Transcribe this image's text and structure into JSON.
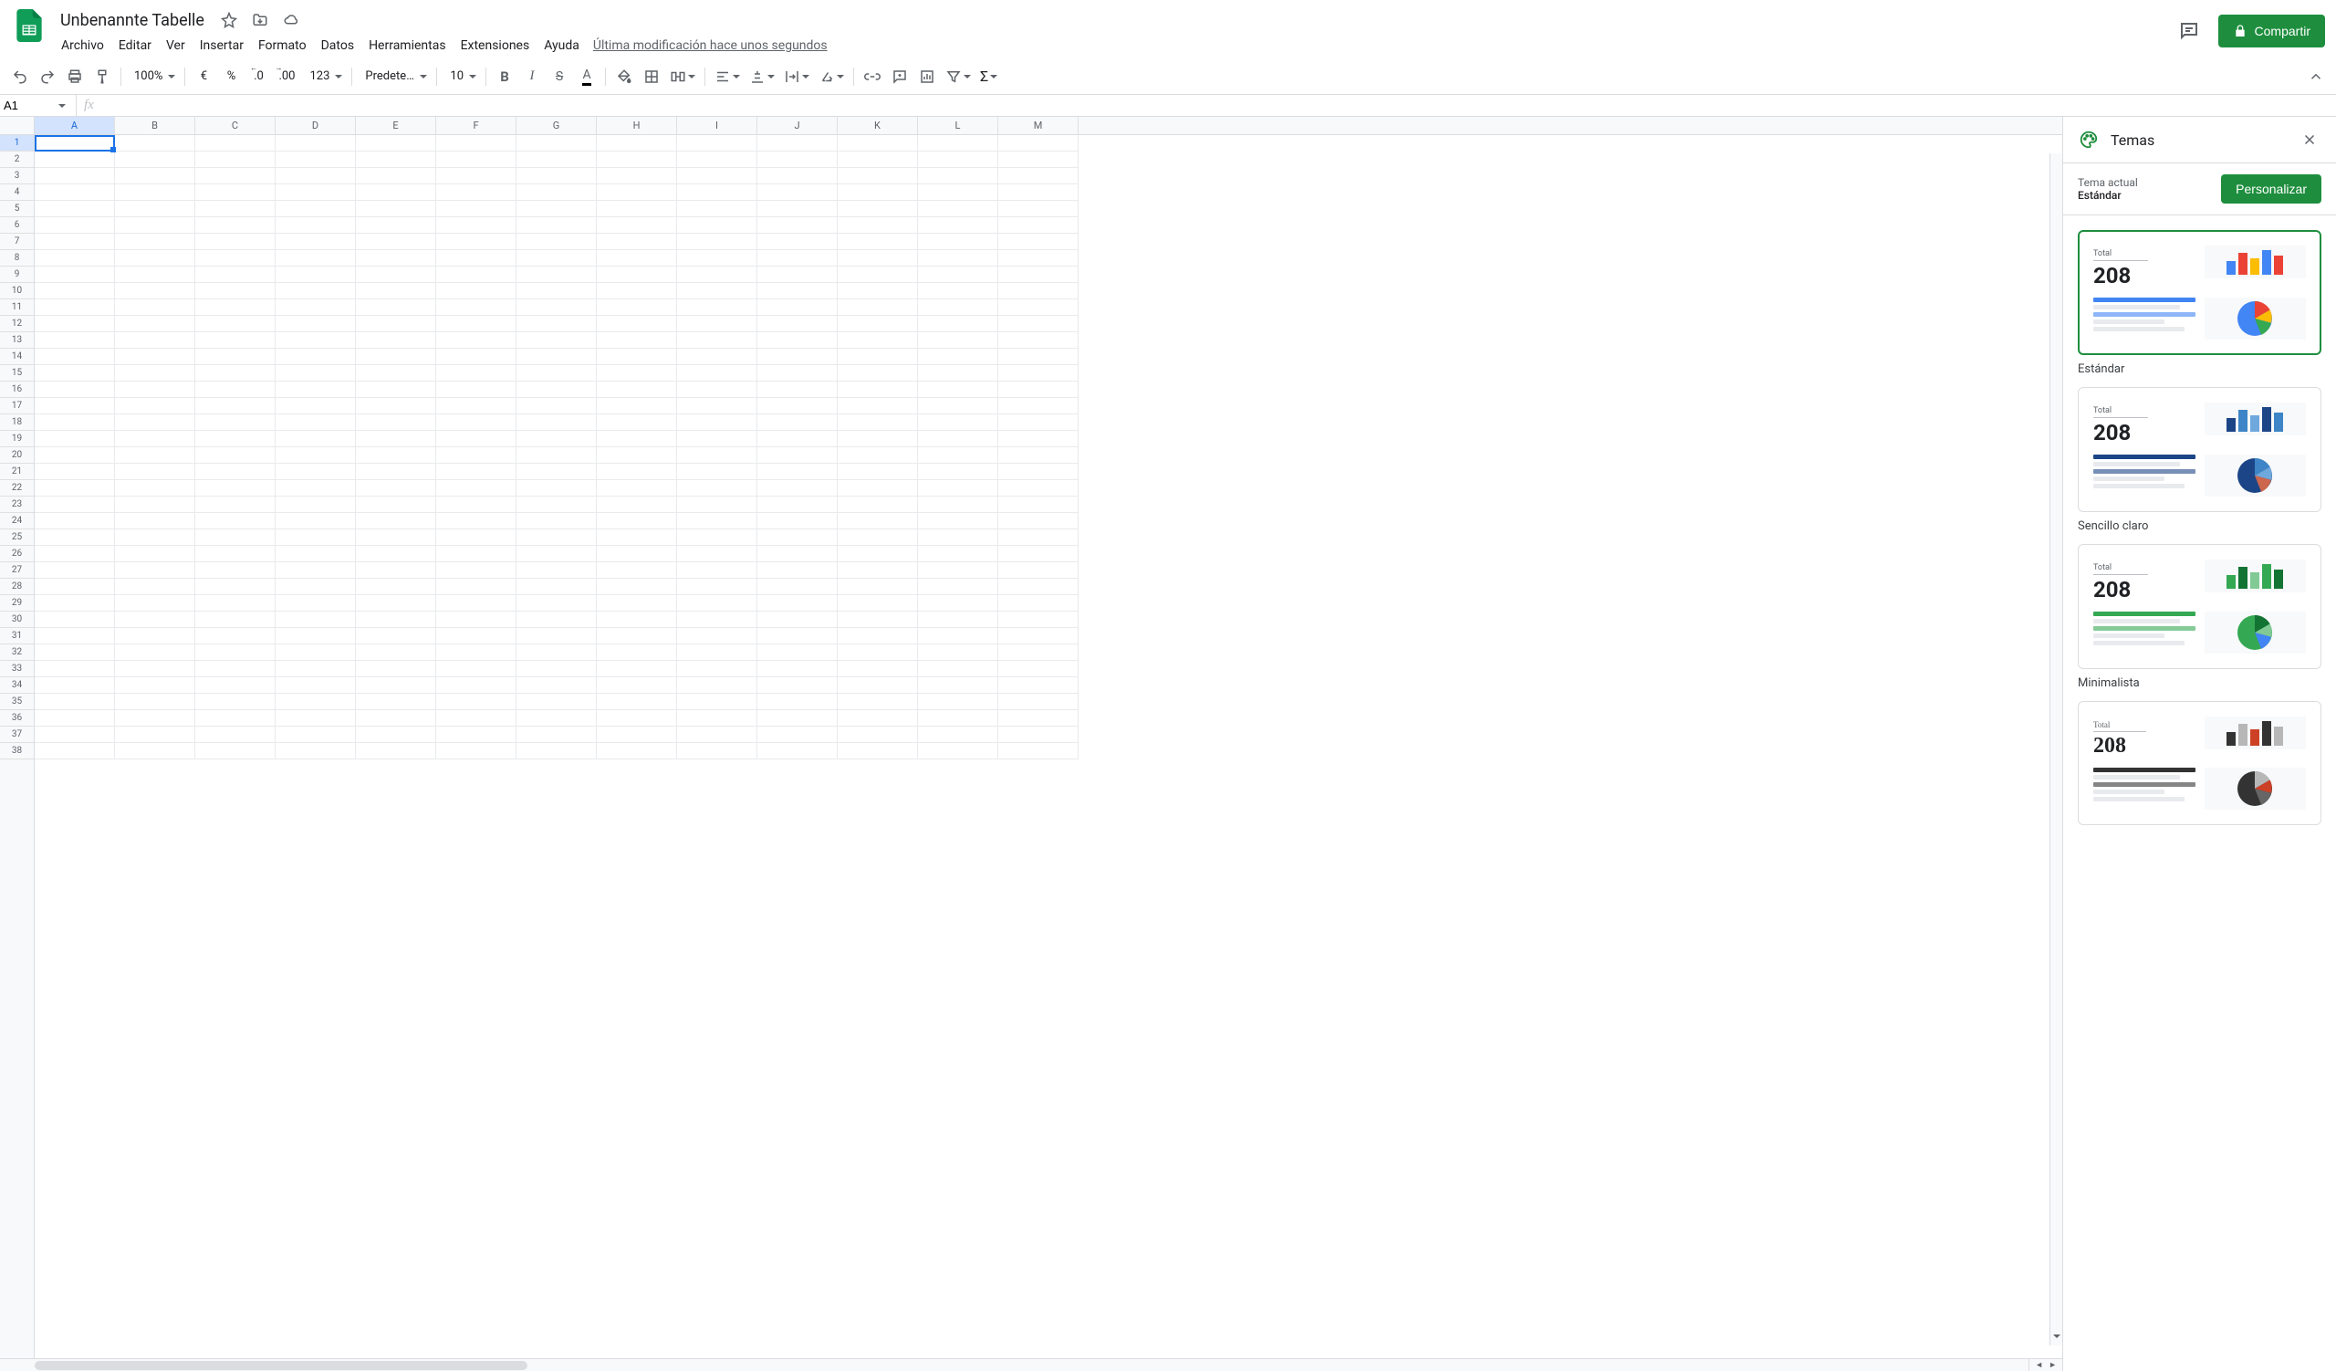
{
  "doc": {
    "title": "Unbenannte Tabelle",
    "last_edit": "Última modificación hace unos segundos"
  },
  "menu": {
    "items": [
      "Archivo",
      "Editar",
      "Ver",
      "Insertar",
      "Formato",
      "Datos",
      "Herramientas",
      "Extensiones",
      "Ayuda"
    ]
  },
  "toolbar": {
    "zoom": "100%",
    "currency": "€",
    "percent": "%",
    "dec_minus": ".0",
    "dec_plus": ".00",
    "numfmt": "123",
    "font": "Predetermi...",
    "fontsize": "10"
  },
  "namebox": {
    "value": "A1"
  },
  "share": {
    "label": "Compartir"
  },
  "columns": [
    "A",
    "B",
    "C",
    "D",
    "E",
    "F",
    "G",
    "H",
    "I",
    "J",
    "K",
    "L",
    "M"
  ],
  "rows": 38,
  "panel": {
    "title": "Temas",
    "current_label": "Tema actual",
    "current_value": "Estándar",
    "customize": "Personalizar",
    "themes": [
      {
        "name": "Estándar",
        "selected": true,
        "font": "sans",
        "palette": [
          "#4285f4",
          "#ea4335",
          "#fbbc04",
          "#34a853",
          "#5f6368"
        ]
      },
      {
        "name": "Sencillo claro",
        "selected": false,
        "font": "sans",
        "palette": [
          "#1c4587",
          "#3d85c6",
          "#6fa8dc",
          "#cc664d",
          "#5f6368"
        ]
      },
      {
        "name": "Minimalista",
        "selected": false,
        "font": "sans",
        "palette": [
          "#34a853",
          "#137333",
          "#81c995",
          "#4285f4",
          "#5f6368"
        ]
      },
      {
        "name": "",
        "selected": false,
        "font": "serif",
        "palette": [
          "#333333",
          "#b7b7b7",
          "#cc4125",
          "#666666",
          "#5f6368"
        ]
      }
    ],
    "sample": {
      "total_label": "Total",
      "total_value": "208"
    }
  }
}
